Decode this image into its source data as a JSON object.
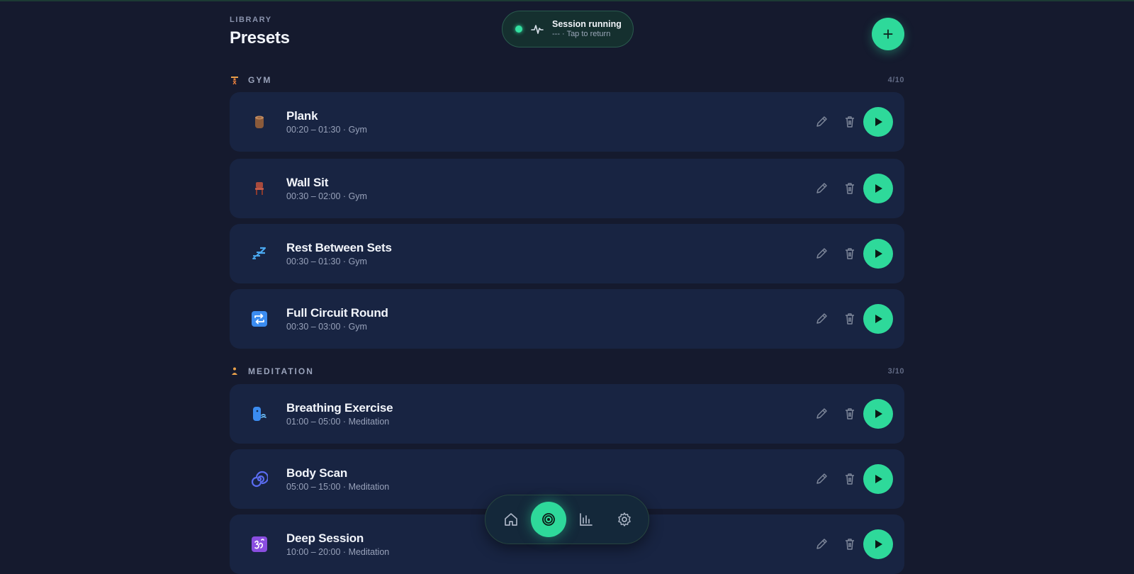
{
  "header": {
    "eyebrow": "LIBRARY",
    "title": "Presets",
    "add_label": "+"
  },
  "session": {
    "title": "Session running",
    "subtitle": "--- · Tap to return",
    "status_color": "#33e0a1"
  },
  "colors": {
    "background": "#151a2e",
    "card": "#182442",
    "accent": "#2ed99a"
  },
  "sections": [
    {
      "name": "GYM",
      "icon": "weightlifter-icon",
      "count": "4/10",
      "presets": [
        {
          "name": "Plank",
          "meta": "00:20 – 01:30 · Gym",
          "icon": "wood-log-icon"
        },
        {
          "name": "Wall Sit",
          "meta": "00:30 – 02:00 · Gym",
          "icon": "chair-icon"
        },
        {
          "name": "Rest Between Sets",
          "meta": "00:30 – 01:30 · Gym",
          "icon": "zzz-icon"
        },
        {
          "name": "Full Circuit Round",
          "meta": "00:30 – 03:00 · Gym",
          "icon": "repeat-icon"
        }
      ]
    },
    {
      "name": "MEDITATION",
      "icon": "lotus-person-icon",
      "count": "3/10",
      "presets": [
        {
          "name": "Breathing Exercise",
          "meta": "01:00 – 05:00 · Meditation",
          "icon": "blowing-face-icon"
        },
        {
          "name": "Body Scan",
          "meta": "05:00 – 15:00 · Meditation",
          "icon": "spiral-icon"
        },
        {
          "name": "Deep Session",
          "meta": "10:00 – 20:00 · Meditation",
          "icon": "om-icon"
        }
      ]
    }
  ],
  "nav": {
    "items": [
      {
        "icon": "home-icon",
        "active": false
      },
      {
        "icon": "target-icon",
        "active": true
      },
      {
        "icon": "stats-icon",
        "active": false
      },
      {
        "icon": "settings-icon",
        "active": false
      }
    ]
  }
}
